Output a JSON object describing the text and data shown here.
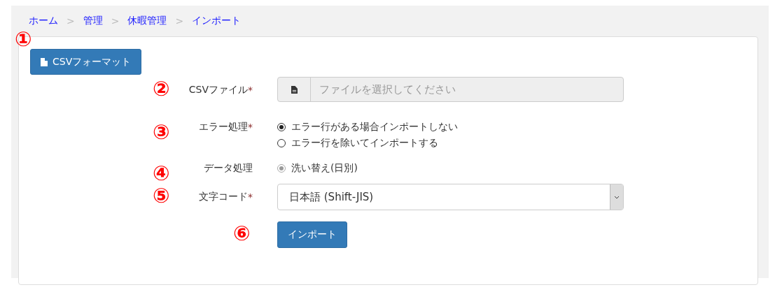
{
  "breadcrumb": [
    {
      "label": "ホーム"
    },
    {
      "label": "管理"
    },
    {
      "label": "休暇管理"
    },
    {
      "label": "インポート"
    }
  ],
  "breadcrumb_separator": ">",
  "format_button": {
    "label": "CSVフォーマット",
    "marker": "①"
  },
  "fields": [
    {
      "kind": "file",
      "label": "CSVファイル",
      "required": true,
      "marker": "②",
      "placeholder": "ファイルを選択してください"
    },
    {
      "kind": "radio",
      "label": "エラー処理",
      "required": true,
      "marker": "③",
      "disabled": false,
      "options": [
        {
          "label": "エラー行がある場合インポートしない",
          "selected": true
        },
        {
          "label": "エラー行を除いてインポートする",
          "selected": false
        }
      ]
    },
    {
      "kind": "radio",
      "label": "データ処理",
      "required": false,
      "marker": "④",
      "disabled": true,
      "options": [
        {
          "label": "洗い替え(日別)",
          "selected": true
        }
      ]
    },
    {
      "kind": "select",
      "label": "文字コード",
      "required": true,
      "marker": "⑤",
      "value": "日本語 (Shift-JIS)"
    }
  ],
  "required_mark": "*",
  "import_button": {
    "label": "インポート",
    "marker": "⑥"
  }
}
